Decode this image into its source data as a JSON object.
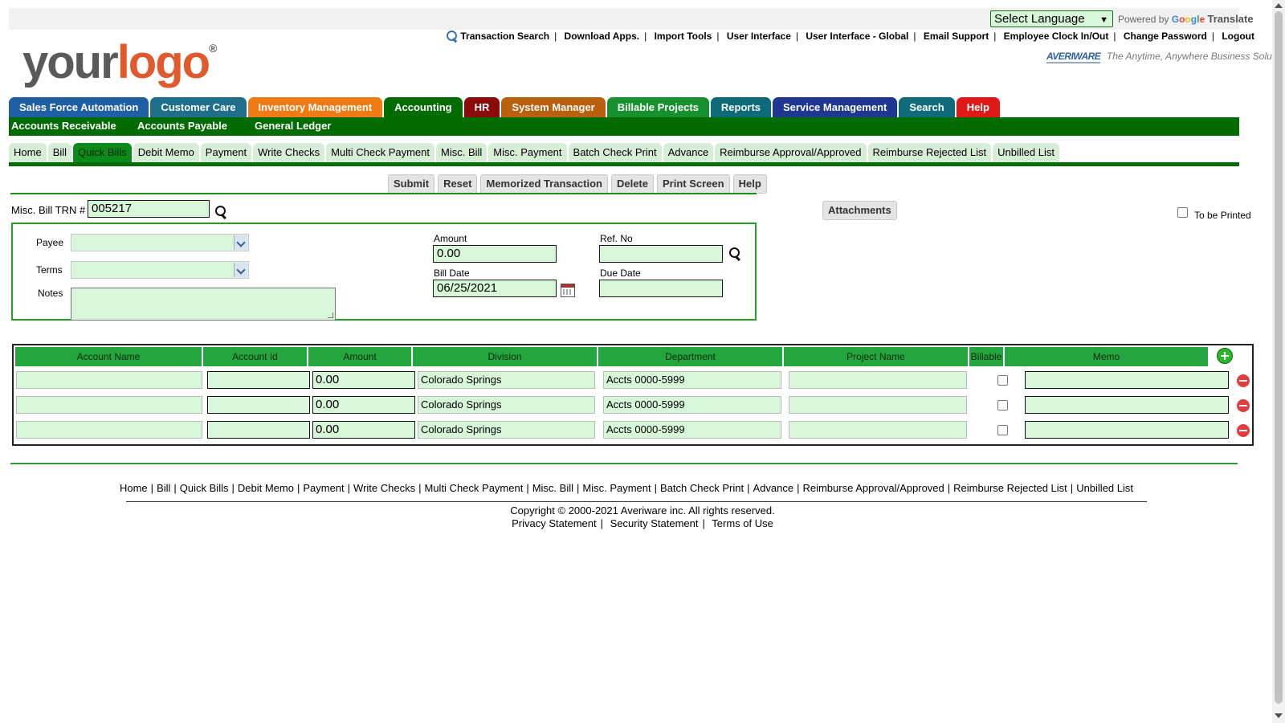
{
  "translate": {
    "select_label": "Select Language",
    "powered_by": "Powered by",
    "google": "Google",
    "translate": "Translate"
  },
  "top_links": [
    "Transaction Search",
    "Download Apps.",
    "Import Tools",
    "User Interface",
    "User Interface - Global",
    "Email Support",
    "Employee Clock In/Out",
    "Change Password",
    "Logout"
  ],
  "logo": {
    "part1": "your",
    "part2": "logo",
    "reg": "®"
  },
  "averiware": {
    "brand": "AVERIWARE",
    "tagline": "The Anytime, Anywhere Business Solution"
  },
  "main_tabs": [
    {
      "label": "Sales Force Automation",
      "color": "#1f5fa6"
    },
    {
      "label": "Customer Care",
      "color": "#1f6f8b"
    },
    {
      "label": "Inventory Management",
      "color": "#f07a13"
    },
    {
      "label": "Accounting",
      "color": "#026b02"
    },
    {
      "label": "HR",
      "color": "#8b0a0a"
    },
    {
      "label": "System Manager",
      "color": "#b8600e"
    },
    {
      "label": "Billable Projects",
      "color": "#17912f"
    },
    {
      "label": "Reports",
      "color": "#0d6a78"
    },
    {
      "label": "Service Management",
      "color": "#1f3790"
    },
    {
      "label": "Search",
      "color": "#0f6a7a"
    },
    {
      "label": "Help",
      "color": "#e01818"
    }
  ],
  "sub_nav": [
    "Accounts Receivable",
    "Accounts Payable",
    "General Ledger"
  ],
  "sub_tabs": [
    "Home",
    "Bill",
    "Quick Bills",
    "Debit Memo",
    "Payment",
    "Write Checks",
    "Multi Check Payment",
    "Misc. Bill",
    "Misc. Payment",
    "Batch Check Print",
    "Advance",
    "Reimburse Approval/Approved",
    "Reimburse Rejected List",
    "Unbilled List"
  ],
  "active_sub_tab": "Quick Bills",
  "actions": [
    "Submit",
    "Reset",
    "Memorized Transaction",
    "Delete",
    "Print Screen",
    "Help"
  ],
  "form": {
    "trn_label": "Misc. Bill TRN #",
    "trn_value": "005217",
    "attachments_label": "Attachments",
    "to_be_printed_label": "To be Printed",
    "payee_label": "Payee",
    "terms_label": "Terms",
    "notes_label": "Notes",
    "amount_label": "Amount",
    "amount_value": "0.00",
    "ref_label": "Ref. No",
    "ref_value": "",
    "bill_date_label": "Bill Date",
    "bill_date_value": "06/25/2021",
    "due_date_label": "Due Date",
    "due_date_value": ""
  },
  "grid": {
    "headers": [
      "Account Name",
      "Account Id",
      "Amount",
      "Division",
      "Department",
      "Project Name",
      "Billable",
      "Memo"
    ],
    "rows": [
      {
        "account_name": "",
        "account_id": "",
        "amount": "0.00",
        "division": "Colorado Springs",
        "department": "Accts 0000-5999",
        "project": "",
        "memo": ""
      },
      {
        "account_name": "",
        "account_id": "",
        "amount": "0.00",
        "division": "Colorado Springs",
        "department": "Accts 0000-5999",
        "project": "",
        "memo": ""
      },
      {
        "account_name": "",
        "account_id": "",
        "amount": "0.00",
        "division": "Colorado Springs",
        "department": "Accts 0000-5999",
        "project": "",
        "memo": ""
      }
    ]
  },
  "footer": {
    "nav": [
      "Home",
      "Bill",
      "Quick Bills",
      "Debit Memo",
      "Payment",
      "Write Checks",
      "Multi Check Payment",
      "Misc. Bill",
      "Misc. Payment",
      "Batch Check Print",
      "Advance",
      "Reimburse Approval/Approved",
      "Reimburse Rejected List",
      "Unbilled List"
    ],
    "copyright": "Copyright © 2000-2021 Averiware inc. All rights reserved.",
    "legal": [
      "Privacy Statement",
      "Security Statement",
      "Terms of Use"
    ]
  }
}
